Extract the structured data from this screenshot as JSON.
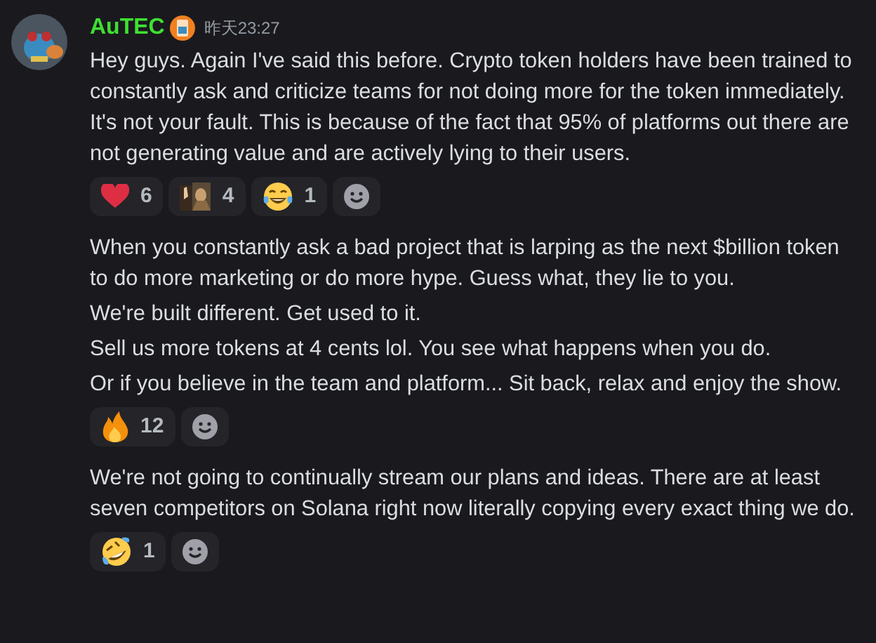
{
  "message": {
    "author": "AuTEC",
    "timestamp": "昨天23:27",
    "groups": [
      {
        "paragraphs": [
          "Hey guys. Again I've said this before. Crypto token holders have been trained to constantly ask and criticize teams for not doing more for the token immediately. It's not your fault. This is because of the fact that 95% of platforms out there are not generating value and are actively lying to their users."
        ],
        "reactions": [
          {
            "kind": "heart",
            "count": "6"
          },
          {
            "kind": "custom",
            "count": "4"
          },
          {
            "kind": "joy",
            "count": "1"
          }
        ]
      },
      {
        "paragraphs": [
          "When you constantly ask a bad project that is larping as the next $billion token to do more marketing or do more hype. Guess what, they lie to you.",
          "We're built different. Get used to it.",
          "Sell us more tokens at 4 cents lol. You see what happens when you do.",
          "Or if you believe in the team and platform... Sit back, relax and enjoy the show."
        ],
        "reactions": [
          {
            "kind": "fire",
            "count": "12"
          }
        ]
      },
      {
        "paragraphs": [
          "We're not going to continually stream our plans and ideas. There are at least seven competitors on Solana right now literally copying every exact thing we do."
        ],
        "reactions": [
          {
            "kind": "rofl",
            "count": "1"
          }
        ]
      }
    ]
  }
}
